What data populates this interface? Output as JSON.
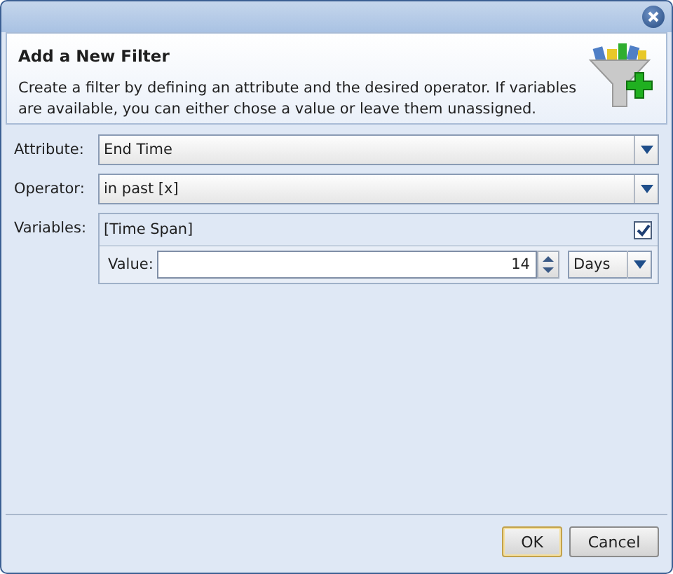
{
  "header": {
    "title": "Add a New Filter",
    "description": "Create a filter by defining an attribute and the desired operator. If variables are available, you can either chose a value or leave them unassigned."
  },
  "fields": [
    {
      "label": "Attribute:",
      "value": "End Time"
    },
    {
      "label": "Operator:",
      "value": "in past [x]"
    }
  ],
  "variables": {
    "label": "Variables:",
    "name": "[Time Span]",
    "checked": true,
    "value_label": "Value:",
    "value": "14",
    "unit": "Days"
  },
  "buttons": [
    {
      "label": "OK",
      "selected": true
    },
    {
      "label": "Cancel",
      "selected": false
    }
  ]
}
